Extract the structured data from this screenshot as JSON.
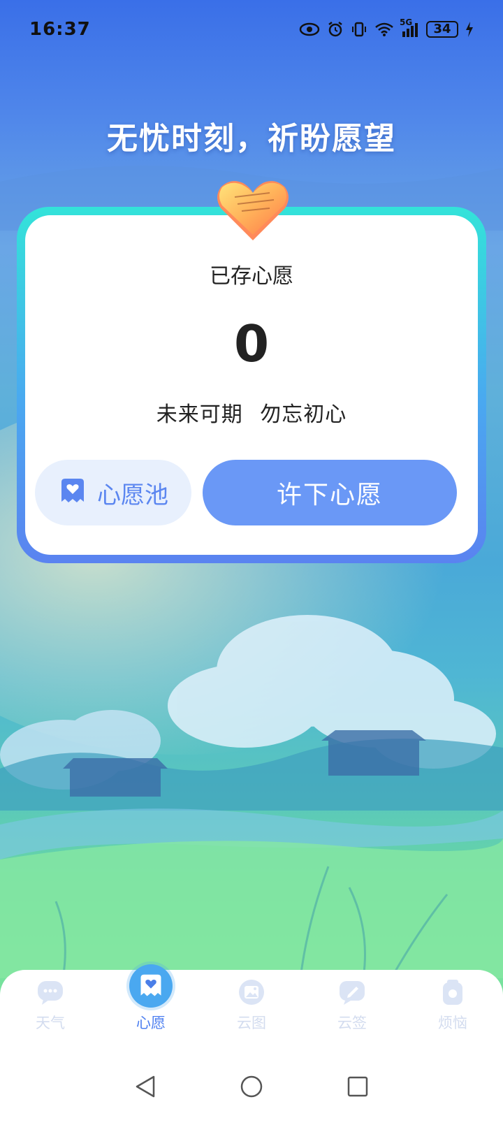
{
  "status_bar": {
    "time": "16:37",
    "battery": "34",
    "network": "5G",
    "icons": [
      "eye-icon",
      "alarm-icon",
      "vibrate-icon",
      "wifi-icon",
      "signal-icon",
      "battery-icon",
      "charging-icon"
    ]
  },
  "headline": "无忧时刻，祈盼愿望",
  "card": {
    "label": "已存心愿",
    "count": "0",
    "motto": "未来可期 勿忘初心",
    "pool_button": "心愿池",
    "wish_button": "许下心愿"
  },
  "tabs": [
    {
      "label": "天气",
      "icon": "chat-bubble-icon",
      "active": false
    },
    {
      "label": "心愿",
      "icon": "ghost-heart-icon",
      "active": true
    },
    {
      "label": "云图",
      "icon": "image-icon",
      "active": false
    },
    {
      "label": "云签",
      "icon": "pencil-note-icon",
      "active": false
    },
    {
      "label": "烦恼",
      "icon": "bag-icon",
      "active": false
    }
  ],
  "nav": [
    "back-icon",
    "home-icon",
    "recents-icon"
  ],
  "colors": {
    "accent": "#6a98f6",
    "active_tab": "#4d7ff0",
    "inactive_tab": "#d3dcef",
    "card_frame_top": "#33e3d9",
    "card_frame_bottom": "#5a83f0"
  }
}
